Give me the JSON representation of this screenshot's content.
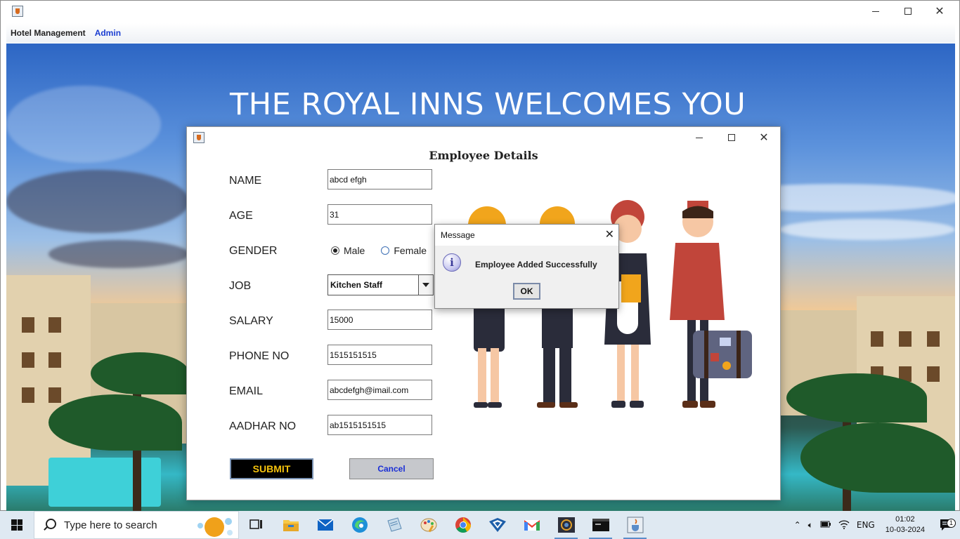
{
  "window": {
    "menu": {
      "hotel_management": "Hotel Management",
      "admin": "Admin"
    }
  },
  "background": {
    "welcome_text": "THE ROYAL INNS WELCOMES YOU"
  },
  "employee_dialog": {
    "title": "Employee Details",
    "fields": {
      "name": {
        "label": "NAME",
        "value": "abcd efgh"
      },
      "age": {
        "label": "AGE",
        "value": "31"
      },
      "gender": {
        "label": "GENDER",
        "options": [
          "Male",
          "Female"
        ],
        "selected": "Male"
      },
      "job": {
        "label": "JOB",
        "value": "Kitchen Staff"
      },
      "salary": {
        "label": "SALARY",
        "value": "15000"
      },
      "phone": {
        "label": "PHONE NO",
        "value": "1515151515"
      },
      "email": {
        "label": "EMAIL",
        "value": "abcdefgh@imail.com"
      },
      "aadhar": {
        "label": "AADHAR NO",
        "value": "ab1515151515"
      }
    },
    "buttons": {
      "submit": "SUBMIT",
      "cancel": "Cancel"
    }
  },
  "message_dialog": {
    "title": "Message",
    "text": "Employee Added Successfully",
    "ok": "OK",
    "icon": "info-icon"
  },
  "taskbar": {
    "search_placeholder": "Type here to search",
    "apps": [
      "task-view-icon",
      "file-explorer-icon",
      "mail-icon",
      "edge-icon",
      "notepad-icon",
      "paint-icon",
      "chrome-icon",
      "vpn-icon",
      "gmail-icon",
      "mysql-workbench-icon",
      "terminal-icon",
      "java-icon"
    ],
    "tray": {
      "language": "ENG",
      "time": "01:02",
      "date": "10-03-2024",
      "notifications": "1"
    }
  },
  "colors": {
    "submit_bg": "#000000",
    "submit_text": "#f4c20d",
    "cancel_text": "#1a2fd6",
    "admin_menu": "#1a3dd1"
  }
}
